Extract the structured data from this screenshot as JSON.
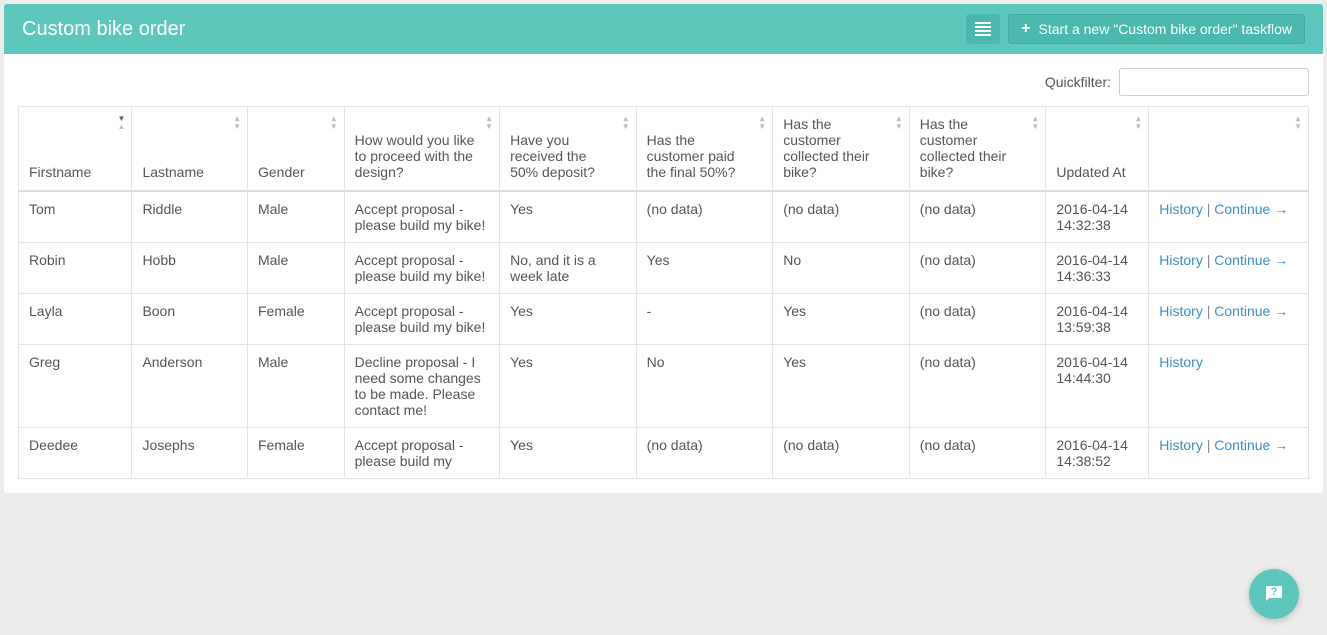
{
  "header": {
    "title": "Custom bike order",
    "start_button_label": "Start a new \"Custom bike order\"  taskflow"
  },
  "filter": {
    "label": "Quickfilter:",
    "value": ""
  },
  "columns": [
    "Firstname",
    "Lastname",
    "Gender",
    "How would you like to proceed with the design?",
    "Have you received the 50% deposit?",
    "Has the customer paid the final 50%?",
    "Has the customer collected their bike?",
    "Has the customer collected their bike?",
    "Updated At",
    ""
  ],
  "rows": [
    {
      "firstname": "Tom",
      "lastname": "Riddle",
      "gender": "Male",
      "proceed": "Accept proposal - please build my bike!",
      "deposit": "Yes",
      "final50": "(no data)",
      "collected1": "(no data)",
      "collected2": "(no data)",
      "updated": "2016-04-14 14:32:38",
      "has_continue": true
    },
    {
      "firstname": "Robin",
      "lastname": "Hobb",
      "gender": "Male",
      "proceed": "Accept proposal - please build my bike!",
      "deposit": "No, and it is a week late",
      "final50": "Yes",
      "collected1": "No",
      "collected2": "(no data)",
      "updated": "2016-04-14 14:36:33",
      "has_continue": true
    },
    {
      "firstname": "Layla",
      "lastname": "Boon",
      "gender": "Female",
      "proceed": "Accept proposal - please build my bike!",
      "deposit": "Yes",
      "final50": "-",
      "collected1": "Yes",
      "collected2": "(no data)",
      "updated": "2016-04-14 13:59:38",
      "has_continue": true
    },
    {
      "firstname": "Greg",
      "lastname": "Anderson",
      "gender": "Male",
      "proceed": "Decline proposal - I need some changes to be made. Please contact me!",
      "deposit": "Yes",
      "final50": "No",
      "collected1": "Yes",
      "collected2": "(no data)",
      "updated": "2016-04-14 14:44:30",
      "has_continue": false
    },
    {
      "firstname": "Deedee",
      "lastname": "Josephs",
      "gender": "Female",
      "proceed": "Accept proposal - please build my",
      "deposit": "Yes",
      "final50": "(no data)",
      "collected1": "(no data)",
      "collected2": "(no data)",
      "updated": "2016-04-14 14:38:52",
      "has_continue": true
    }
  ],
  "actions": {
    "history": "History",
    "continue": "Continue",
    "arrow": "→"
  }
}
